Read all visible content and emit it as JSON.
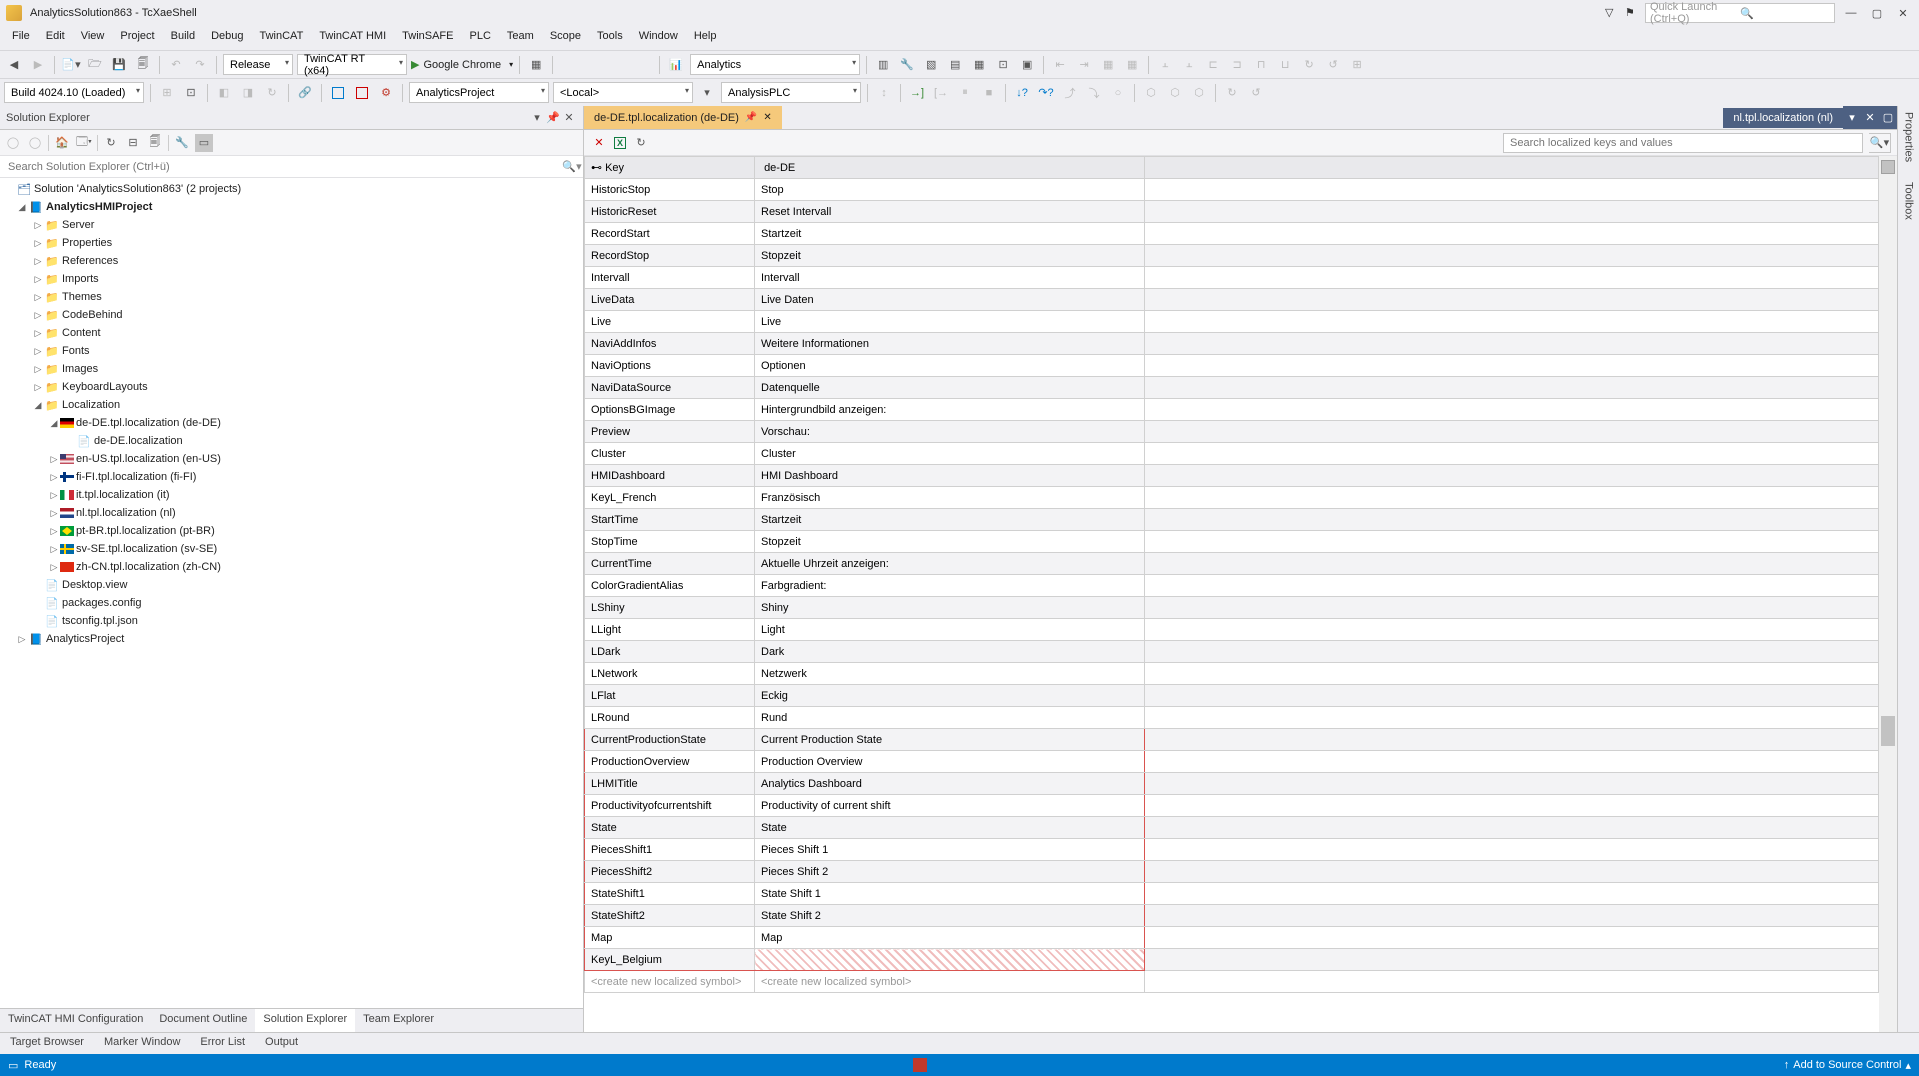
{
  "window": {
    "title": "AnalyticsSolution863 - TcXaeShell",
    "quick_launch_placeholder": "Quick Launch (Ctrl+Q)"
  },
  "menu": [
    "File",
    "Edit",
    "View",
    "Project",
    "Build",
    "Debug",
    "TwinCAT",
    "TwinCAT HMI",
    "TwinSAFE",
    "PLC",
    "Team",
    "Scope",
    "Tools",
    "Window",
    "Help"
  ],
  "toolbar1": {
    "config": "Release",
    "target": "TwinCAT RT (x64)",
    "run_label": "Google Chrome",
    "analytics": "Analytics"
  },
  "toolbar2": {
    "build": "Build 4024.10 (Loaded)",
    "project": "AnalyticsProject",
    "local": "<Local>",
    "plc": "AnalysisPLC"
  },
  "solution_explorer": {
    "title": "Solution Explorer",
    "search_placeholder": "Search Solution Explorer (Ctrl+ü)",
    "root": "Solution 'AnalyticsSolution863' (2 projects)",
    "hmi_project": "AnalyticsHMIProject",
    "folders": [
      "Server",
      "Properties",
      "References",
      "Imports",
      "Themes",
      "CodeBehind",
      "Content",
      "Fonts",
      "Images",
      "KeyboardLayouts",
      "Localization"
    ],
    "loc_items": [
      {
        "label": "de-DE.tpl.localization (de-DE)",
        "flag": "de",
        "expanded": true
      },
      {
        "label": "de-DE.localization",
        "flag": "file"
      },
      {
        "label": "en-US.tpl.localization (en-US)",
        "flag": "us"
      },
      {
        "label": "fi-FI.tpl.localization (fi-FI)",
        "flag": "fi"
      },
      {
        "label": "it.tpl.localization (it)",
        "flag": "it"
      },
      {
        "label": "nl.tpl.localization (nl)",
        "flag": "nl"
      },
      {
        "label": "pt-BR.tpl.localization (pt-BR)",
        "flag": "br"
      },
      {
        "label": "sv-SE.tpl.localization (sv-SE)",
        "flag": "sv"
      },
      {
        "label": "zh-CN.tpl.localization (zh-CN)",
        "flag": "cn"
      }
    ],
    "extra_files": [
      "Desktop.view",
      "packages.config",
      "tsconfig.tpl.json"
    ],
    "other_project": "AnalyticsProject",
    "bottom_tabs": [
      "TwinCAT HMI Configuration",
      "Document Outline",
      "Solution Explorer",
      "Team Explorer"
    ]
  },
  "editor": {
    "active_tab": "de-DE.tpl.localization (de-DE)",
    "inactive_tab": "nl.tpl.localization (nl)",
    "search_placeholder": "Search localized keys and values",
    "headers": {
      "key": "Key",
      "locale": "de-DE"
    },
    "rows": [
      {
        "k": "HistoricStop",
        "v": "Stop"
      },
      {
        "k": "HistoricReset",
        "v": "Reset Intervall"
      },
      {
        "k": "RecordStart",
        "v": "Startzeit"
      },
      {
        "k": "RecordStop",
        "v": "Stopzeit"
      },
      {
        "k": "Intervall",
        "v": "Intervall"
      },
      {
        "k": "LiveData",
        "v": "Live Daten"
      },
      {
        "k": "Live",
        "v": "Live"
      },
      {
        "k": "NaviAddInfos",
        "v": "Weitere Informationen"
      },
      {
        "k": "NaviOptions",
        "v": "Optionen"
      },
      {
        "k": "NaviDataSource",
        "v": "Datenquelle"
      },
      {
        "k": "OptionsBGImage",
        "v": "Hintergrundbild anzeigen:"
      },
      {
        "k": "Preview",
        "v": "Vorschau:"
      },
      {
        "k": "Cluster",
        "v": "Cluster"
      },
      {
        "k": "HMIDashboard",
        "v": "HMI Dashboard"
      },
      {
        "k": "KeyL_French",
        "v": "Französisch"
      },
      {
        "k": "StartTime",
        "v": "Startzeit"
      },
      {
        "k": "StopTime",
        "v": "Stopzeit"
      },
      {
        "k": "CurrentTime",
        "v": "Aktuelle Uhrzeit anzeigen:"
      },
      {
        "k": "ColorGradientAlias",
        "v": "Farbgradient:"
      },
      {
        "k": "LShiny",
        "v": "Shiny"
      },
      {
        "k": "LLight",
        "v": "Light"
      },
      {
        "k": "LDark",
        "v": "Dark"
      },
      {
        "k": "LNetwork",
        "v": "Netzwerk"
      },
      {
        "k": "LFlat",
        "v": "Eckig"
      },
      {
        "k": "LRound",
        "v": "Rund"
      },
      {
        "k": "CurrentProductionState",
        "v": "Current Production State",
        "hl": true
      },
      {
        "k": "ProductionOverview",
        "v": "Production Overview",
        "hl": true
      },
      {
        "k": "LHMITitle",
        "v": "Analytics Dashboard",
        "hl": true
      },
      {
        "k": "Productivityofcurrentshift",
        "v": "Productivity of current shift",
        "hl": true
      },
      {
        "k": "State",
        "v": "State",
        "hl": true
      },
      {
        "k": "PiecesShift1",
        "v": "Pieces Shift 1",
        "hl": true
      },
      {
        "k": "PiecesShift2",
        "v": "Pieces Shift 2",
        "hl": true
      },
      {
        "k": "StateShift1",
        "v": "State Shift 1",
        "hl": true
      },
      {
        "k": "StateShift2",
        "v": "State Shift 2",
        "hl": true
      },
      {
        "k": "Map",
        "v": "Map",
        "hl": true
      },
      {
        "k": "KeyL_Belgium",
        "v": "",
        "hl": true,
        "hatch": true
      }
    ],
    "new_row": "<create new localized symbol>"
  },
  "output_tabs": [
    "Target Browser",
    "Marker Window",
    "Error List",
    "Output"
  ],
  "right_tabs": [
    "Properties",
    "Toolbox"
  ],
  "status": {
    "ready": "Ready",
    "add_source": "Add to Source Control"
  }
}
